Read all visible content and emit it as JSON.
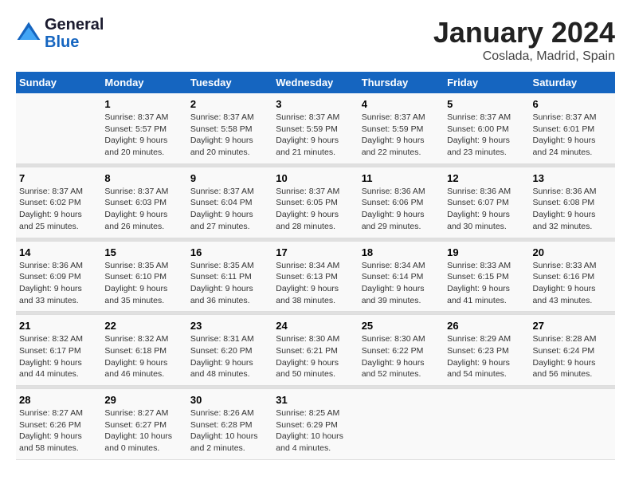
{
  "logo": {
    "line1": "General",
    "line2": "Blue"
  },
  "title": "January 2024",
  "location": "Coslada, Madrid, Spain",
  "weekdays": [
    "Sunday",
    "Monday",
    "Tuesday",
    "Wednesday",
    "Thursday",
    "Friday",
    "Saturday"
  ],
  "weeks": [
    [
      {
        "day": "",
        "info": ""
      },
      {
        "day": "1",
        "info": "Sunrise: 8:37 AM\nSunset: 5:57 PM\nDaylight: 9 hours\nand 20 minutes."
      },
      {
        "day": "2",
        "info": "Sunrise: 8:37 AM\nSunset: 5:58 PM\nDaylight: 9 hours\nand 20 minutes."
      },
      {
        "day": "3",
        "info": "Sunrise: 8:37 AM\nSunset: 5:59 PM\nDaylight: 9 hours\nand 21 minutes."
      },
      {
        "day": "4",
        "info": "Sunrise: 8:37 AM\nSunset: 5:59 PM\nDaylight: 9 hours\nand 22 minutes."
      },
      {
        "day": "5",
        "info": "Sunrise: 8:37 AM\nSunset: 6:00 PM\nDaylight: 9 hours\nand 23 minutes."
      },
      {
        "day": "6",
        "info": "Sunrise: 8:37 AM\nSunset: 6:01 PM\nDaylight: 9 hours\nand 24 minutes."
      }
    ],
    [
      {
        "day": "7",
        "info": "Sunrise: 8:37 AM\nSunset: 6:02 PM\nDaylight: 9 hours\nand 25 minutes."
      },
      {
        "day": "8",
        "info": "Sunrise: 8:37 AM\nSunset: 6:03 PM\nDaylight: 9 hours\nand 26 minutes."
      },
      {
        "day": "9",
        "info": "Sunrise: 8:37 AM\nSunset: 6:04 PM\nDaylight: 9 hours\nand 27 minutes."
      },
      {
        "day": "10",
        "info": "Sunrise: 8:37 AM\nSunset: 6:05 PM\nDaylight: 9 hours\nand 28 minutes."
      },
      {
        "day": "11",
        "info": "Sunrise: 8:36 AM\nSunset: 6:06 PM\nDaylight: 9 hours\nand 29 minutes."
      },
      {
        "day": "12",
        "info": "Sunrise: 8:36 AM\nSunset: 6:07 PM\nDaylight: 9 hours\nand 30 minutes."
      },
      {
        "day": "13",
        "info": "Sunrise: 8:36 AM\nSunset: 6:08 PM\nDaylight: 9 hours\nand 32 minutes."
      }
    ],
    [
      {
        "day": "14",
        "info": "Sunrise: 8:36 AM\nSunset: 6:09 PM\nDaylight: 9 hours\nand 33 minutes."
      },
      {
        "day": "15",
        "info": "Sunrise: 8:35 AM\nSunset: 6:10 PM\nDaylight: 9 hours\nand 35 minutes."
      },
      {
        "day": "16",
        "info": "Sunrise: 8:35 AM\nSunset: 6:11 PM\nDaylight: 9 hours\nand 36 minutes."
      },
      {
        "day": "17",
        "info": "Sunrise: 8:34 AM\nSunset: 6:13 PM\nDaylight: 9 hours\nand 38 minutes."
      },
      {
        "day": "18",
        "info": "Sunrise: 8:34 AM\nSunset: 6:14 PM\nDaylight: 9 hours\nand 39 minutes."
      },
      {
        "day": "19",
        "info": "Sunrise: 8:33 AM\nSunset: 6:15 PM\nDaylight: 9 hours\nand 41 minutes."
      },
      {
        "day": "20",
        "info": "Sunrise: 8:33 AM\nSunset: 6:16 PM\nDaylight: 9 hours\nand 43 minutes."
      }
    ],
    [
      {
        "day": "21",
        "info": "Sunrise: 8:32 AM\nSunset: 6:17 PM\nDaylight: 9 hours\nand 44 minutes."
      },
      {
        "day": "22",
        "info": "Sunrise: 8:32 AM\nSunset: 6:18 PM\nDaylight: 9 hours\nand 46 minutes."
      },
      {
        "day": "23",
        "info": "Sunrise: 8:31 AM\nSunset: 6:20 PM\nDaylight: 9 hours\nand 48 minutes."
      },
      {
        "day": "24",
        "info": "Sunrise: 8:30 AM\nSunset: 6:21 PM\nDaylight: 9 hours\nand 50 minutes."
      },
      {
        "day": "25",
        "info": "Sunrise: 8:30 AM\nSunset: 6:22 PM\nDaylight: 9 hours\nand 52 minutes."
      },
      {
        "day": "26",
        "info": "Sunrise: 8:29 AM\nSunset: 6:23 PM\nDaylight: 9 hours\nand 54 minutes."
      },
      {
        "day": "27",
        "info": "Sunrise: 8:28 AM\nSunset: 6:24 PM\nDaylight: 9 hours\nand 56 minutes."
      }
    ],
    [
      {
        "day": "28",
        "info": "Sunrise: 8:27 AM\nSunset: 6:26 PM\nDaylight: 9 hours\nand 58 minutes."
      },
      {
        "day": "29",
        "info": "Sunrise: 8:27 AM\nSunset: 6:27 PM\nDaylight: 10 hours\nand 0 minutes."
      },
      {
        "day": "30",
        "info": "Sunrise: 8:26 AM\nSunset: 6:28 PM\nDaylight: 10 hours\nand 2 minutes."
      },
      {
        "day": "31",
        "info": "Sunrise: 8:25 AM\nSunset: 6:29 PM\nDaylight: 10 hours\nand 4 minutes."
      },
      {
        "day": "",
        "info": ""
      },
      {
        "day": "",
        "info": ""
      },
      {
        "day": "",
        "info": ""
      }
    ]
  ]
}
